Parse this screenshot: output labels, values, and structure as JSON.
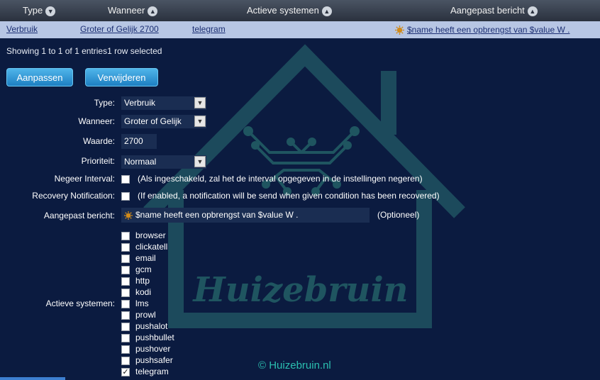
{
  "table": {
    "headers": [
      {
        "label": "Type",
        "sort": "desc"
      },
      {
        "label": "Wanneer",
        "sort": "asc"
      },
      {
        "label": "Actieve systemen",
        "sort": "asc"
      },
      {
        "label": "Aangepast bericht",
        "sort": "asc"
      }
    ],
    "rows": [
      {
        "type": "Verbruik",
        "wanneer": "Groter of Gelijk 2700",
        "systemen": "telegram",
        "bericht": "$name heeft een opbrengst van $value W ."
      }
    ],
    "info": "Showing 1 to 1 of 1 entries1 row selected"
  },
  "buttons": {
    "edit": "Aanpassen",
    "delete": "Verwijderen"
  },
  "form": {
    "type_label": "Type:",
    "type_value": "Verbruik",
    "wanneer_label": "Wanneer:",
    "wanneer_value": "Groter of Gelijk",
    "waarde_label": "Waarde:",
    "waarde_value": "2700",
    "prioriteit_label": "Prioriteit:",
    "prioriteit_value": "Normaal",
    "negeer_label": "Negeer Interval:",
    "negeer_checked": false,
    "negeer_hint": "(Als ingeschakeld, zal het de interval opgegeven in de instellingen negeren)",
    "recovery_label": "Recovery Notification:",
    "recovery_checked": false,
    "recovery_hint": "(If enabled, a notification will be send when given condition has been recovered)",
    "bericht_label": "Aangepast bericht:",
    "bericht_value": "$name heeft een opbrengst van $value W .",
    "bericht_hint": "(Optioneel)",
    "systemen_label": "Actieve systemen:",
    "systemen": [
      {
        "name": "browser",
        "checked": false
      },
      {
        "name": "clickatell",
        "checked": false
      },
      {
        "name": "email",
        "checked": false
      },
      {
        "name": "gcm",
        "checked": false
      },
      {
        "name": "http",
        "checked": false
      },
      {
        "name": "kodi",
        "checked": false
      },
      {
        "name": "lms",
        "checked": false
      },
      {
        "name": "prowl",
        "checked": false
      },
      {
        "name": "pushalot",
        "checked": false
      },
      {
        "name": "pushbullet",
        "checked": false
      },
      {
        "name": "pushover",
        "checked": false
      },
      {
        "name": "pushsafer",
        "checked": false
      },
      {
        "name": "telegram",
        "checked": true
      }
    ]
  },
  "watermark": {
    "text": "Huizebruin"
  },
  "copyright": "© Huizebruin.nl",
  "colors": {
    "background": "#0b1b40",
    "row_selected": "#b7c6e4",
    "button": "#2a94d6",
    "watermark": "#1f5560",
    "copyright": "#2bbfb0"
  }
}
